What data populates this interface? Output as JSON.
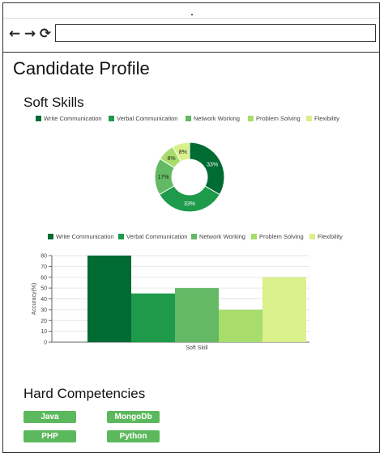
{
  "browser": {
    "back_glyph": "←",
    "forward_glyph": "→",
    "reload_glyph": "⟳",
    "address_value": ""
  },
  "page": {
    "title": "Candidate Profile",
    "soft_skills_title": "Soft Skills",
    "hard_title": "Hard Competencies"
  },
  "colors": {
    "write": "#006b32",
    "verbal": "#1e9a4b",
    "network": "#63b964",
    "problem": "#a8dd6c",
    "flexibility": "#daf08b",
    "button": "#5cb85c"
  },
  "legend": [
    {
      "label": "Write Communication",
      "color": "#006b32"
    },
    {
      "label": "Verbal Communication",
      "color": "#1e9a4b"
    },
    {
      "label": "Network Working",
      "color": "#63b964"
    },
    {
      "label": "Problem Solving",
      "color": "#a8dd6c"
    },
    {
      "label": "Flexibility",
      "color": "#daf08b"
    }
  ],
  "chart_data": [
    {
      "type": "pie",
      "categories": [
        "Write Communication",
        "Verbal Communication",
        "Network Working",
        "Problem Solving",
        "Flexibility"
      ],
      "values": [
        33,
        33,
        17,
        8,
        8
      ],
      "labels": [
        "33%",
        "33%",
        "17%",
        "8%",
        "8%"
      ],
      "legend_position": "top"
    },
    {
      "type": "bar",
      "categories": [
        "Soft Skill"
      ],
      "series": [
        {
          "name": "Write Communication",
          "values": [
            80
          ]
        },
        {
          "name": "Verbal Communication",
          "values": [
            45
          ]
        },
        {
          "name": "Network Working",
          "values": [
            50
          ]
        },
        {
          "name": "Problem Solving",
          "values": [
            30
          ]
        },
        {
          "name": "Flexibility",
          "values": [
            60
          ]
        }
      ],
      "ylabel": "Accuracy(%)",
      "ylim": [
        0,
        80
      ],
      "yticks": [
        0,
        10,
        20,
        30,
        40,
        50,
        60,
        70,
        80
      ],
      "grid": true,
      "legend_position": "top"
    }
  ],
  "hard_skills": [
    "Java",
    "MongoDb",
    "PHP",
    "Python"
  ]
}
